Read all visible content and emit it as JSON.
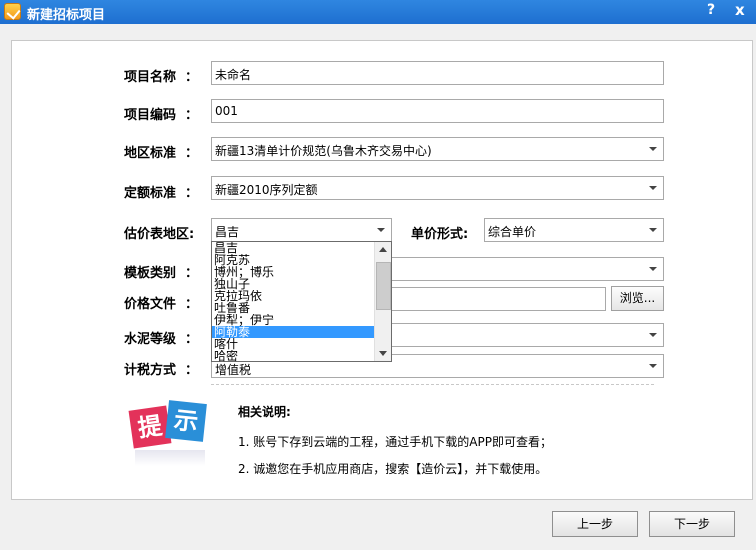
{
  "window": {
    "title": "新建招标项目",
    "help": "?",
    "close": "x"
  },
  "form": {
    "project_name": {
      "label": "项目名称",
      "colon": "：",
      "value": "未命名"
    },
    "project_code": {
      "label": "项目编码",
      "colon": "：",
      "value": "001"
    },
    "region_standard": {
      "label": "地区标准",
      "colon": "：",
      "value": "新疆13清单计价规范(乌鲁木齐交易中心)"
    },
    "quota_standard": {
      "label": "定额标准",
      "colon": "：",
      "value": "新疆2010序列定额"
    },
    "price_region": {
      "label": "估价表地区:",
      "value": "昌吉",
      "options": [
        "昌吉",
        "阿克苏",
        "博州；博乐",
        "独山子",
        "克拉玛依",
        "吐鲁番",
        "伊犁；伊宁",
        "阿勒泰",
        "喀什",
        "哈密"
      ],
      "selected_index": 7
    },
    "unit_price_form": {
      "label": "单价形式:",
      "value": "综合单价"
    },
    "template_type": {
      "label": "模板类别",
      "colon": "："
    },
    "price_file": {
      "label": "价格文件",
      "colon": "：",
      "browse_label": "浏览..."
    },
    "cement_grade": {
      "label": "水泥等级",
      "colon": "："
    },
    "tax_method": {
      "label": "计税方式",
      "colon": "：",
      "value": "增值税"
    }
  },
  "hint": {
    "tile_1": "提",
    "tile_2": "示",
    "title": "相关说明:",
    "lines": [
      "1. 账号下存到云端的工程，通过手机下载的APP即可查看；",
      "2. 诚邀您在手机应用商店，搜索【造价云】，并下载使用。"
    ]
  },
  "buttons": {
    "prev": "上一步",
    "next": "下一步"
  }
}
